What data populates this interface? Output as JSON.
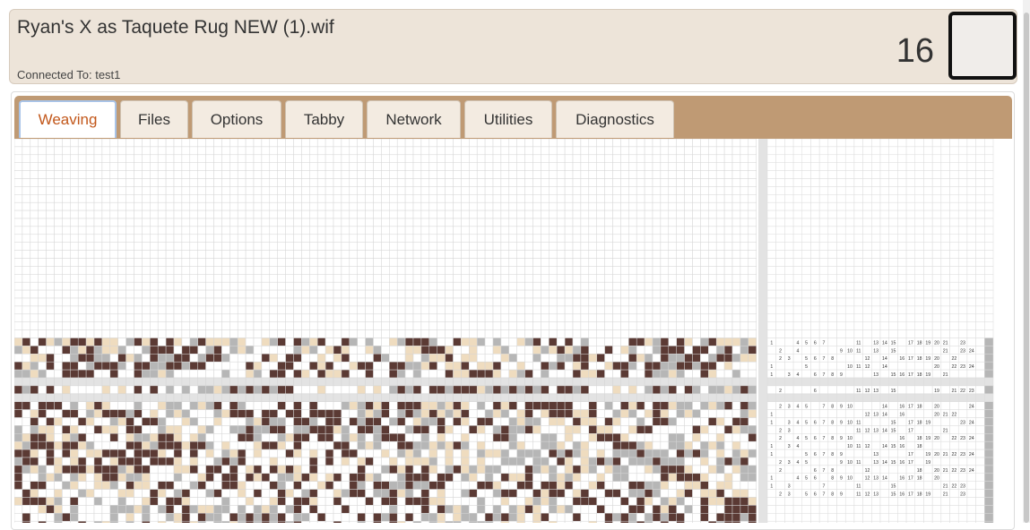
{
  "header": {
    "filename": "Ryan's X as Taquete Rug NEW (1).wif",
    "connection": "Connected To: test1",
    "pick_number": "16"
  },
  "tabs": [
    {
      "label": "Weaving",
      "active": true
    },
    {
      "label": "Files",
      "active": false
    },
    {
      "label": "Options",
      "active": false
    },
    {
      "label": "Tabby",
      "active": false
    },
    {
      "label": "Network",
      "active": false
    },
    {
      "label": "Utilities",
      "active": false
    },
    {
      "label": "Diagnostics",
      "active": false
    }
  ],
  "colors": {
    "dark_brown": "#5b3a34",
    "tan": "#efdcbf",
    "gray": "#b6b6b6",
    "white": "#ffffff",
    "tab_bar": "#bf9a74",
    "accent_active": "#c2571a"
  },
  "liftplan": {
    "total_columns": 24,
    "rows": [
      "1 . . 4 5 6 7 . . . 11 . 13 14 15 . 17 18 19 20 21 . 23 .",
      ". 2 . 4 . . . . 9 10 11 . 13 . 15 . . . . . 21 . 23 24",
      ". 2 3 . 5 6 7 8 . . . 12 . 14 . 16 17 18 19 20 . 22 . .",
      "1 . . . 5 . . . . 10 11 12 . 14 . . . . . 20 . 22 23 24",
      "1 . 3 4 . 6 7 8 9 . . . 13 . 15 16 17 18 19 . 21 . . .",
      ". 2 . . . 6 . . . . 11 12 13 . 15 . . . . 19 . 21 22 23",
      ". 2 3 4 5 . 7 8 9 10 . . . 14 . 16 17 18 . 20 . . . 24",
      "1 . . . . . . . . . . 12 13 14 . 16 . . . 20 21 22 . .",
      "1 . 3 4 5 6 7 8 9 10 11 . . . 15 . 17 18 19 . . . 23 24",
      ". 2 3 . . . . . . . 11 12 13 14 15 . 17 . . . 21 . . .",
      ". 2 . 4 5 6 7 8 9 10 . . . . . 16 . 18 19 20 . 22 23 24",
      "1 . 3 4 . . . . . 10 11 12 . 14 15 16 . 18 . . . . . .",
      "1 . . . 5 6 7 8 9 . . . 13 . . . 17 . 19 20 21 22 23 24",
      ". 2 3 4 5 . . . 9 10 11 . 13 14 15 16 17 . 19 . . . . .",
      ". 2 . . . 6 7 8 . . . 12 . . . . . 18 . 20 21 22 23 24",
      "1 . . 4 5 6 . 8 9 10 . 12 13 14 . 16 17 18 . 20 . . . .",
      "1 . 3 . . . 7 . . . 11 . . . 15 . . . . . 21 22 23 .",
      ". 2 3 . 5 6 7 8 9 . 11 12 13 . 15 16 17 18 19 . 21 . 23 ."
    ]
  }
}
